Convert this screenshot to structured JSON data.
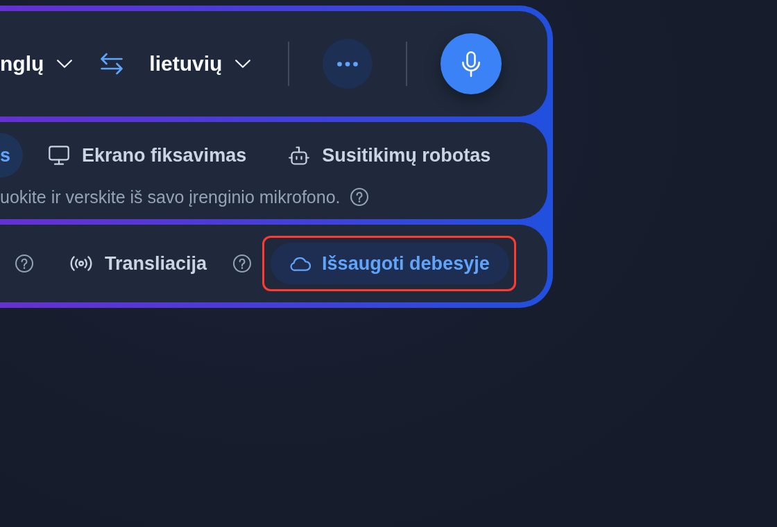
{
  "language_bar": {
    "source_language": "nglų",
    "target_language": "lietuvių"
  },
  "modes": {
    "tabs": [
      {
        "label": "s",
        "selected": true
      },
      {
        "label": "Ekrano fiksavimas",
        "selected": false
      },
      {
        "label": "Susitikimų robotas",
        "selected": false
      }
    ],
    "description": "uokite ir verskite iš savo įrenginio mikrofono."
  },
  "options": [
    {
      "kind": "help"
    },
    {
      "kind": "toggle",
      "label": "Transliacija"
    },
    {
      "kind": "help"
    },
    {
      "kind": "action",
      "label": "Išsaugoti debesyje",
      "highlighted": true
    }
  ]
}
